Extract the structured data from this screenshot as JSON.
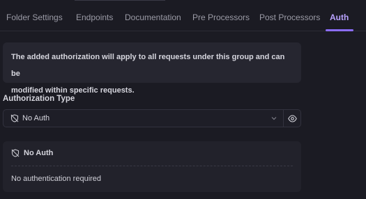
{
  "tabs": [
    {
      "label": "Folder Settings",
      "active": false
    },
    {
      "label": "Endpoints",
      "active": false
    },
    {
      "label": "Documentation",
      "active": false
    },
    {
      "label": "Pre Processors",
      "active": false
    },
    {
      "label": "Post Processors",
      "active": false
    },
    {
      "label": "Auth",
      "active": true
    }
  ],
  "info": {
    "line1": "The added authorization will apply to all requests under this group and can be",
    "line2": "modified within specific requests."
  },
  "auth_type": {
    "label": "Authorization Type",
    "selected": "No Auth",
    "icon": "shield-off-icon"
  },
  "card": {
    "title": "No Auth",
    "description": "No authentication required",
    "icon": "shield-off-icon"
  },
  "colors": {
    "accent": "#8b6dfa",
    "active_tab_text": "#b9a3ff",
    "background": "#1b1b23",
    "panel": "#262630"
  }
}
